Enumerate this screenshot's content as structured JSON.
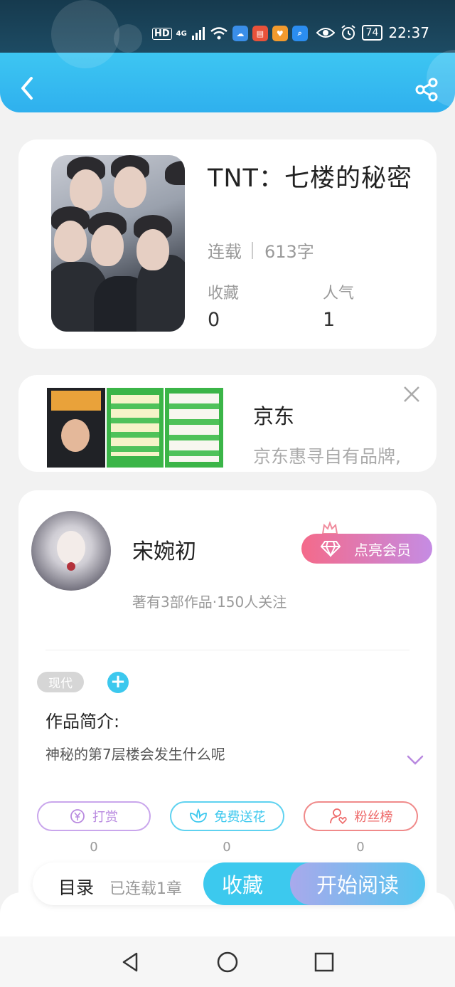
{
  "status_bar": {
    "network": "HD",
    "signal": "4G",
    "battery": "74",
    "time": "22:37"
  },
  "header": {
    "back_icon": "chevron-left-icon",
    "share_icon": "share-icon"
  },
  "book": {
    "title": "TNT：七楼的秘密",
    "status": "连载",
    "word_count": "613字",
    "favorites_label": "收藏",
    "favorites_value": "0",
    "popularity_label": "人气",
    "popularity_value": "1"
  },
  "ad": {
    "title": "京东",
    "description": "京东惠寻自有品牌,",
    "close_icon": "close-icon"
  },
  "author": {
    "name": "宋婉初",
    "vip_label": "点亮会员",
    "stats": "著有3部作品·150人关注"
  },
  "tags": [
    "现代"
  ],
  "add_tag_label": "+",
  "intro": {
    "title": "作品简介:",
    "text": "神秘的第7层楼会发生什么呢"
  },
  "actions": [
    {
      "label": "打赏",
      "count": "0",
      "icon": "yen-coin-icon",
      "color": "#b98ae0"
    },
    {
      "label": "免费送花",
      "count": "0",
      "icon": "flower-icon",
      "color": "#3cc8ee"
    },
    {
      "label": "粉丝榜",
      "count": "0",
      "icon": "user-heart-icon",
      "color": "#ee6a6a"
    }
  ],
  "bottom_bar": {
    "toc_label": "目录",
    "toc_sub": "已连载1章",
    "favorite_label": "收藏",
    "read_label": "开始阅读"
  },
  "colors": {
    "accent": "#3cc9ee",
    "vip_from": "#f46a8a",
    "vip_to": "#c58ce4"
  }
}
